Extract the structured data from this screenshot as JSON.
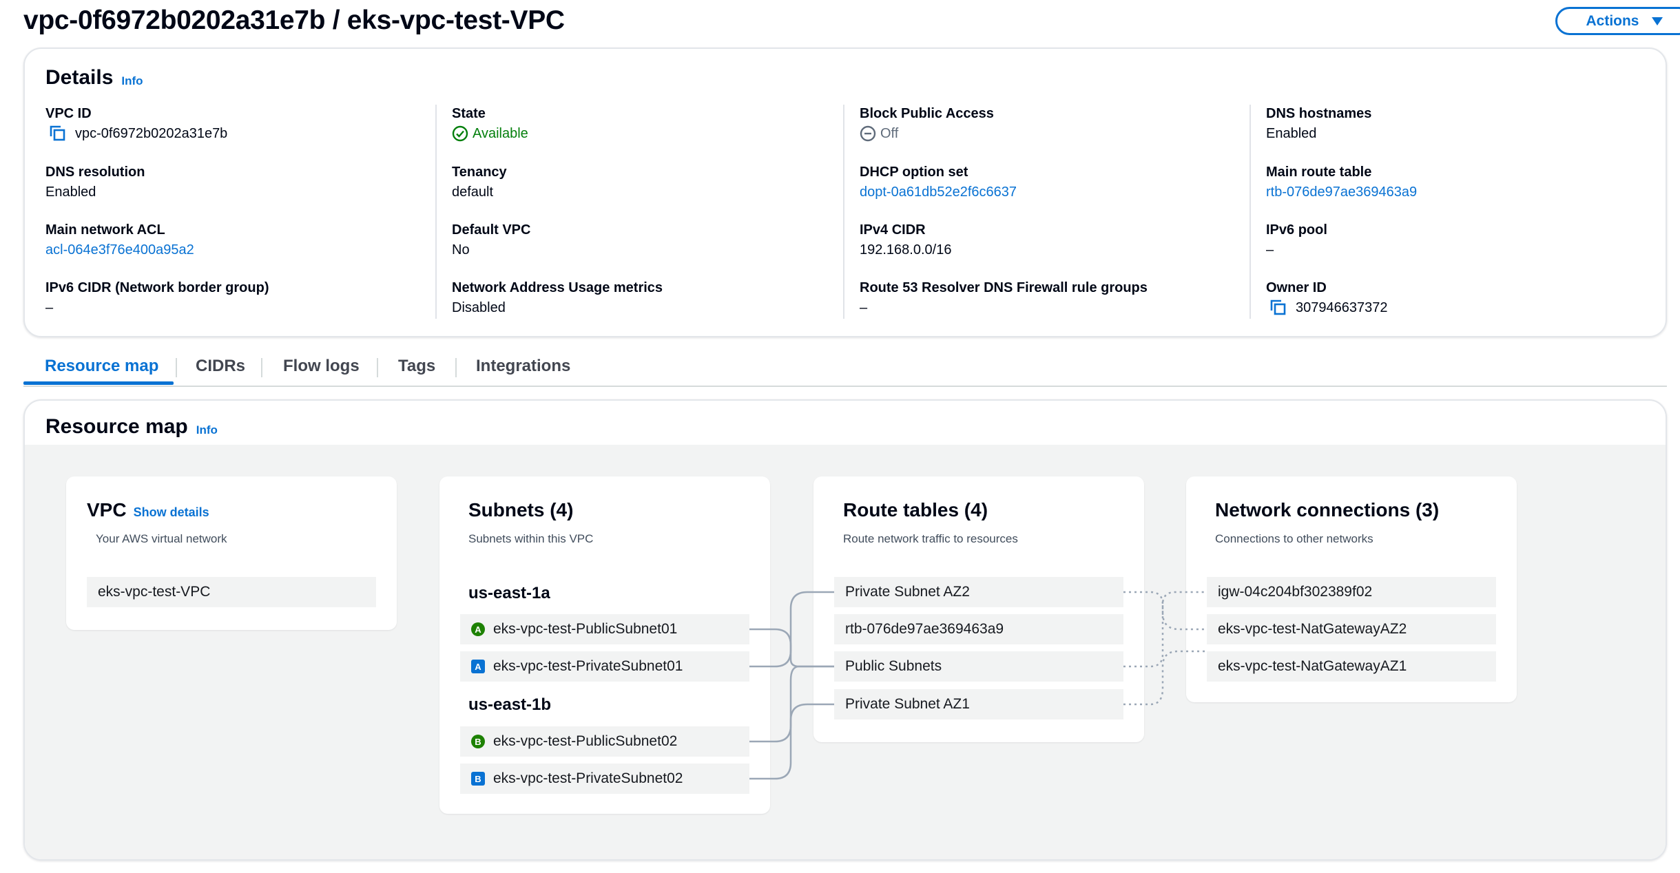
{
  "header": {
    "title": "vpc-0f6972b0202a31e7b / eks-vpc-test-VPC",
    "actions_label": "Actions"
  },
  "details": {
    "title": "Details",
    "info": "Info",
    "fields": {
      "vpc_id": {
        "label": "VPC ID",
        "value": "vpc-0f6972b0202a31e7b"
      },
      "state": {
        "label": "State",
        "value": "Available"
      },
      "block_public_access": {
        "label": "Block Public Access",
        "value": "Off"
      },
      "dns_hostnames": {
        "label": "DNS hostnames",
        "value": "Enabled"
      },
      "dns_resolution": {
        "label": "DNS resolution",
        "value": "Enabled"
      },
      "tenancy": {
        "label": "Tenancy",
        "value": "default"
      },
      "dhcp_option_set": {
        "label": "DHCP option set",
        "value": "dopt-0a61db52e2f6c6637"
      },
      "main_route_table": {
        "label": "Main route table",
        "value": "rtb-076de97ae369463a9"
      },
      "main_network_acl": {
        "label": "Main network ACL",
        "value": "acl-064e3f76e400a95a2"
      },
      "default_vpc": {
        "label": "Default VPC",
        "value": "No"
      },
      "ipv4_cidr": {
        "label": "IPv4 CIDR",
        "value": "192.168.0.0/16"
      },
      "ipv6_pool": {
        "label": "IPv6 pool",
        "value": "–"
      },
      "ipv6_cidr": {
        "label": "IPv6 CIDR (Network border group)",
        "value": "–"
      },
      "network_address_usage": {
        "label": "Network Address Usage metrics",
        "value": "Disabled"
      },
      "route53_firewall": {
        "label": "Route 53 Resolver DNS Firewall rule groups",
        "value": "–"
      },
      "owner_id": {
        "label": "Owner ID",
        "value": "307946637372"
      }
    }
  },
  "tabs": [
    {
      "label": "Resource map",
      "active": true
    },
    {
      "label": "CIDRs",
      "active": false
    },
    {
      "label": "Flow logs",
      "active": false
    },
    {
      "label": "Tags",
      "active": false
    },
    {
      "label": "Integrations",
      "active": false
    }
  ],
  "resource_map": {
    "title": "Resource map",
    "info": "Info",
    "vpc": {
      "title": "VPC",
      "show_details": "Show details",
      "subtitle": "Your AWS virtual network",
      "items": [
        "eks-vpc-test-VPC"
      ]
    },
    "subnets": {
      "title": "Subnets (4)",
      "subtitle": "Subnets within this VPC",
      "zones": [
        {
          "name": "us-east-1a",
          "items": [
            {
              "badge": "A",
              "kind": "public",
              "label": "eks-vpc-test-PublicSubnet01"
            },
            {
              "badge": "A",
              "kind": "private",
              "label": "eks-vpc-test-PrivateSubnet01"
            }
          ]
        },
        {
          "name": "us-east-1b",
          "items": [
            {
              "badge": "B",
              "kind": "public",
              "label": "eks-vpc-test-PublicSubnet02"
            },
            {
              "badge": "B",
              "kind": "private",
              "label": "eks-vpc-test-PrivateSubnet02"
            }
          ]
        }
      ]
    },
    "route_tables": {
      "title": "Route tables (4)",
      "subtitle": "Route network traffic to resources",
      "items": [
        "Private Subnet AZ2",
        "rtb-076de97ae369463a9",
        "Public Subnets",
        "Private Subnet AZ1"
      ]
    },
    "network_connections": {
      "title": "Network connections (3)",
      "subtitle": "Connections to other networks",
      "items": [
        "igw-04c204bf302389f02",
        "eks-vpc-test-NatGatewayAZ2",
        "eks-vpc-test-NatGatewayAZ1"
      ]
    }
  },
  "colors": {
    "link": "#0972d3",
    "success": "#037f0c",
    "public_badge": "#1d8102",
    "private_badge": "#0972d3",
    "map_background": "#f2f3f3"
  }
}
